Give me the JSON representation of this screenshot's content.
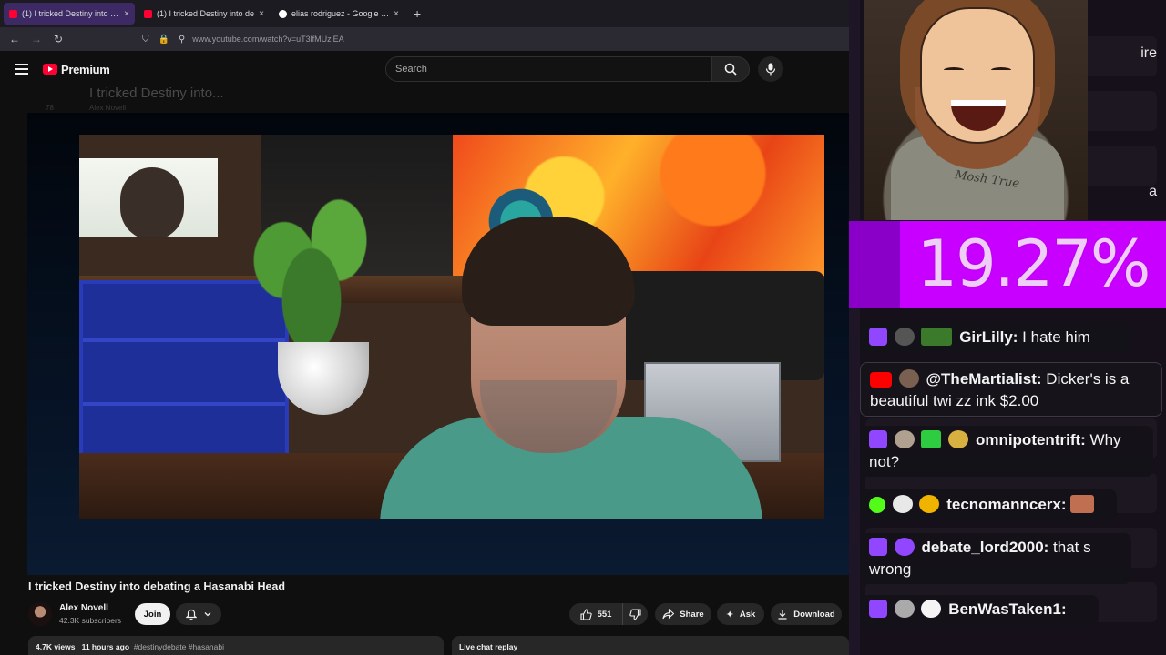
{
  "browser": {
    "tabs": [
      {
        "title": "(1) I tricked Destiny into debating",
        "active": true
      },
      {
        "title": "(1) I tricked Destiny into de",
        "active": false
      },
      {
        "title": "elias rodriguez - Google Search",
        "active": false
      }
    ],
    "close_glyph": "×",
    "new_tab_glyph": "+",
    "url": "www.youtube.com/watch?v=uT3lfMUzlEA"
  },
  "youtube": {
    "logo_text": "Premium",
    "search_placeholder": "Search",
    "ghost_title": "I tricked Destiny into...",
    "ghost_channel": "Alex Novell",
    "ghost_count": "78",
    "video_title": "I tricked Destiny into debating a Hasanabi Head",
    "channel": {
      "name": "Alex Novell",
      "subscribers": "42.3K subscribers"
    },
    "join_label": "Join",
    "like_count": "551",
    "share_label": "Share",
    "ask_label": "Ask",
    "download_label": "Download",
    "more_glyph": "···",
    "description": {
      "views": "4.7K views",
      "time": "11 hours ago",
      "tags": "#destinydebate #hasanabi"
    },
    "chat_replay_label": "Live chat replay"
  },
  "overlay": {
    "percentage": "19.27%",
    "side_text_1": "ire",
    "side_text_2": "a",
    "tank_text": "Mosh True",
    "messages": [
      {
        "platform": "twitch",
        "user": "GirLilly:",
        "text": "I hate him",
        "amount": ""
      },
      {
        "platform": "youtube",
        "user": "@TheMartialist:",
        "text": "Dicker's is a beautiful twi zz ink",
        "amount": "$2.00"
      },
      {
        "platform": "twitch",
        "user": "omnipotentrift:",
        "text": "Why not?",
        "amount": ""
      },
      {
        "platform": "kick",
        "user": "tecnomanncerx:",
        "text": "",
        "amount": ""
      },
      {
        "platform": "twitch",
        "user": "debate_lord2000:",
        "text": "that s wrong",
        "amount": ""
      },
      {
        "platform": "twitch",
        "user": "BenWasTaken1:",
        "text": "",
        "amount": ""
      }
    ]
  },
  "colors": {
    "twitch": "#9146ff",
    "youtube_red": "#ff0000",
    "percent_bg": "#c800ff",
    "tab_active": "#3d2963"
  }
}
